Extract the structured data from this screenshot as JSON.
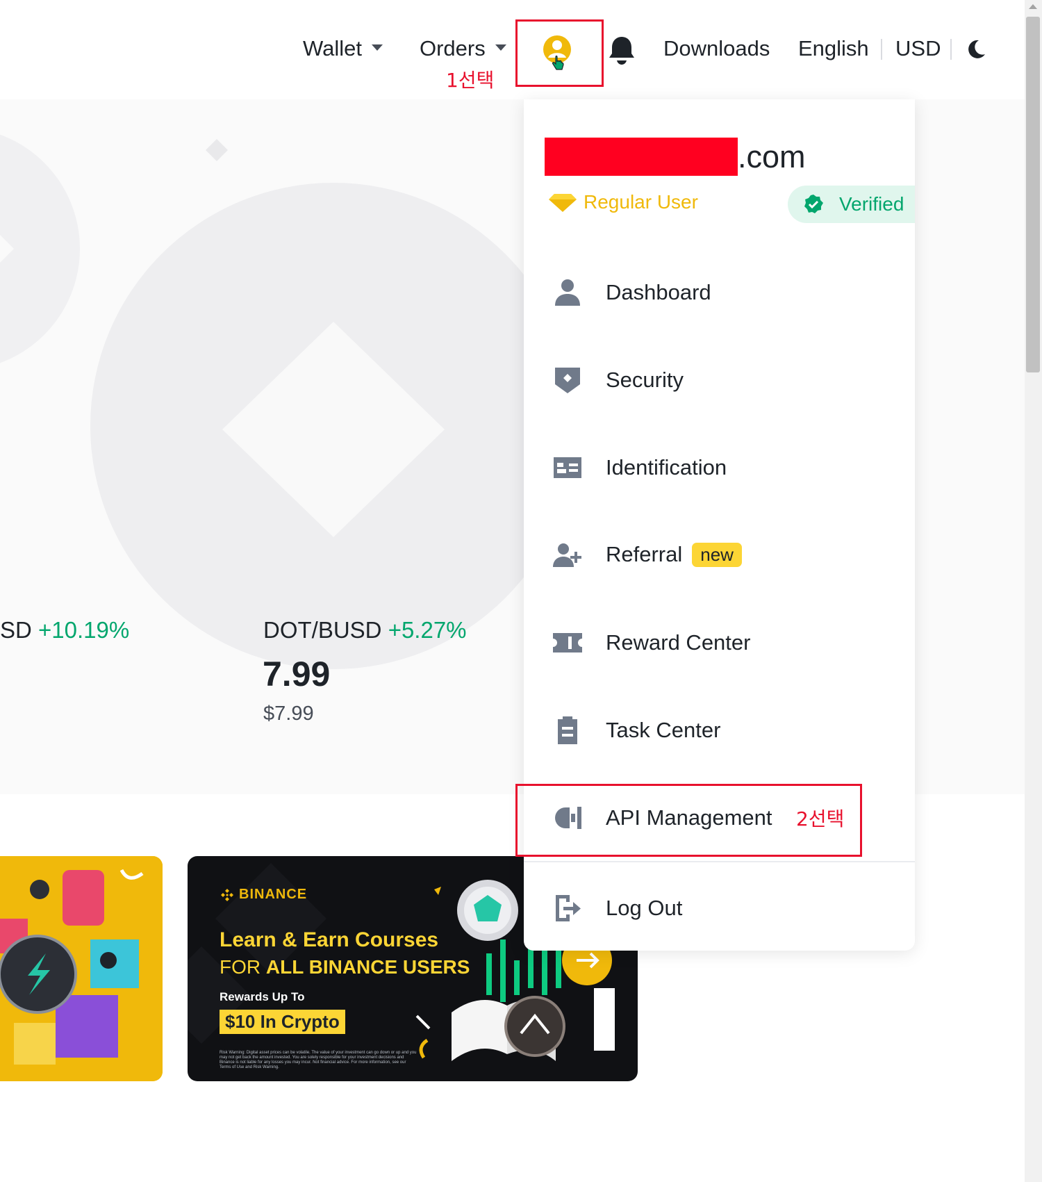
{
  "nav": {
    "wallet": "Wallet",
    "orders": "Orders",
    "downloads": "Downloads",
    "language": "English",
    "currency": "USD",
    "step1_note": "1선택"
  },
  "tickers": [
    {
      "pair": "SD",
      "change": "+10.19%"
    },
    {
      "pair": "DOT/BUSD",
      "change": "+5.27%",
      "price": "7.99",
      "usd": "$7.99"
    }
  ],
  "banner": {
    "brand": "BINANCE",
    "line1": "Learn & Earn Courses",
    "line2_prefix": "FOR",
    "line2_bold": "ALL BINANCE USERS",
    "line3": "Rewards Up To",
    "line4": "$10 In Crypto",
    "disclaimer": "Risk Warning: Digital asset prices can be volatile. The value of your investment can go down or up and you may not get back the amount invested. You are solely responsible for your investment decisions and Binance is not liable for any losses you may incur. Not financial advice. For more information, see our Terms of Use and Risk Warning."
  },
  "account": {
    "email_suffix": ".com",
    "level": "Regular User",
    "status": "Verified"
  },
  "menu": [
    {
      "label": "Dashboard",
      "icon": "person-icon"
    },
    {
      "label": "Security",
      "icon": "shield-icon"
    },
    {
      "label": "Identification",
      "icon": "id-card-icon"
    },
    {
      "label": "Referral",
      "icon": "add-user-icon",
      "badge": "new"
    },
    {
      "label": "Reward Center",
      "icon": "ticket-icon"
    },
    {
      "label": "Task Center",
      "icon": "clipboard-icon"
    },
    {
      "label": "API Management",
      "icon": "api-icon",
      "note": "2선택"
    },
    {
      "label": "Log Out",
      "icon": "logout-icon"
    }
  ],
  "colors": {
    "brand_yellow": "#F0B90B",
    "up_green": "#03A66D",
    "annotation_red": "#E8112D"
  }
}
